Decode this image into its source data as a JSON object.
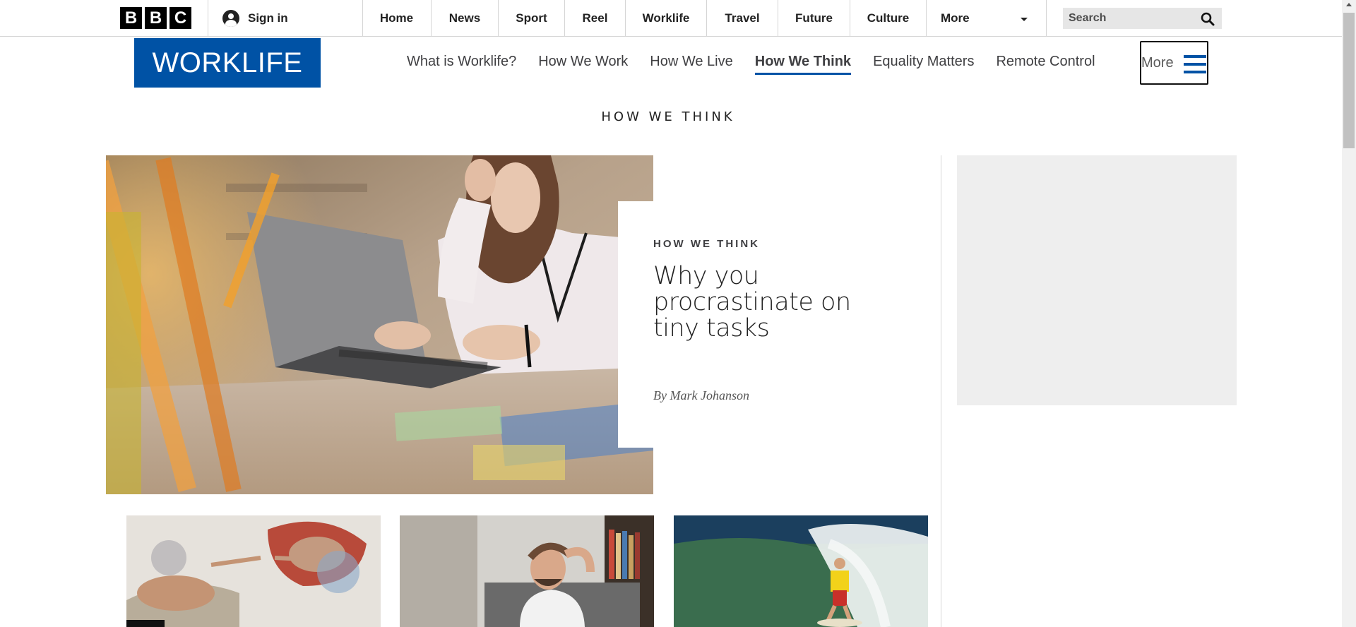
{
  "brand": {
    "letters": [
      "B",
      "B",
      "C"
    ]
  },
  "topbar": {
    "signin_label": "Sign in",
    "nav": [
      "Home",
      "News",
      "Sport",
      "Reel",
      "Worklife",
      "Travel",
      "Future",
      "Culture"
    ],
    "more_label": "More",
    "search_placeholder": "Search"
  },
  "worklife": {
    "logo": "WORKLIFE",
    "subnav": [
      "What is Worklife?",
      "How We Work",
      "How We Live",
      "How We Think",
      "Equality Matters",
      "Remote Control"
    ],
    "active_subnav": "How We Think",
    "more_label": "More"
  },
  "section": {
    "title": "HOW WE THINK"
  },
  "hero": {
    "kicker": "HOW WE THINK",
    "title": "Why you procrastinate on tiny tasks",
    "author": "By Mark Johanson"
  },
  "colors": {
    "brand_blue": "#0052a5",
    "ad_bg": "#eeeeee"
  },
  "icons": {
    "search": "search-icon",
    "menu": "hamburger-icon",
    "user": "user-icon"
  }
}
